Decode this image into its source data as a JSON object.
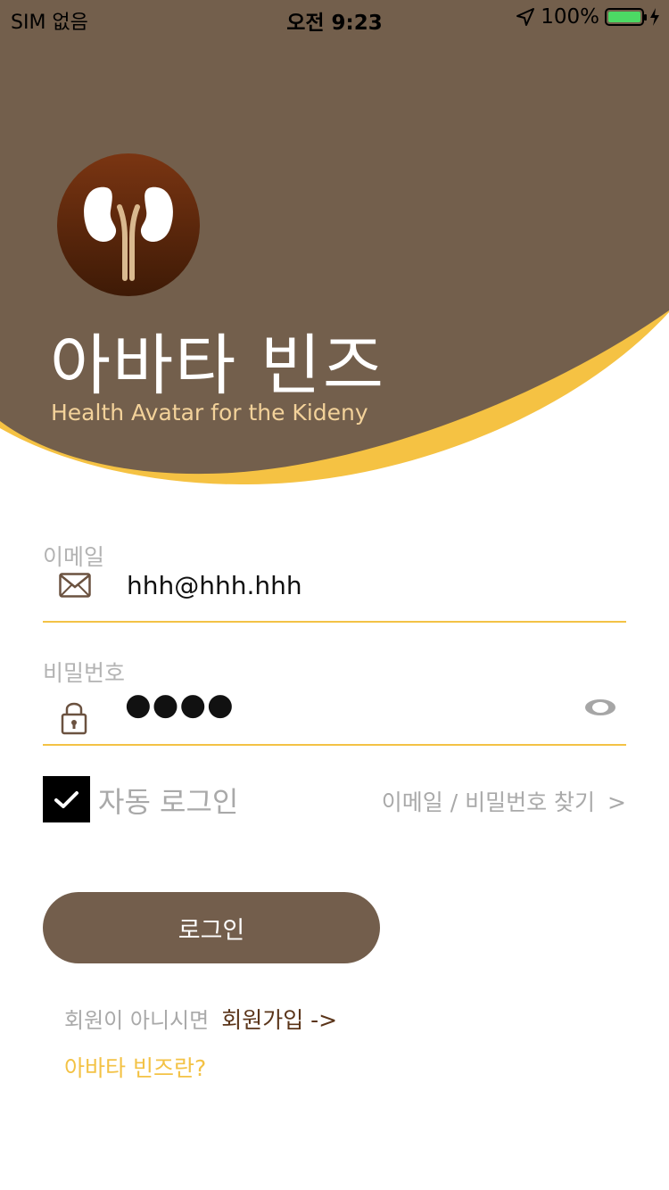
{
  "status_bar": {
    "carrier": "SIM 없음",
    "time": "오전 9:23",
    "battery": "100%"
  },
  "brand": {
    "title": "아바타 빈즈",
    "subtitle": "Health Avatar for the Kideny"
  },
  "form": {
    "email_label": "이메일",
    "email_value": "hhh@hhh.hhh",
    "password_label": "비밀번호",
    "password_masked": "●●●●",
    "auto_login_label": "자동 로그인",
    "auto_login_checked": true,
    "find_link": "이메일 / 비밀번호 찾기",
    "find_arrow": ">",
    "login_button": "로그인",
    "signup_question": "회원이 아니시면",
    "signup_link": "회원가입 ->",
    "about_link": "아바타 빈즈란?"
  },
  "colors": {
    "header_brown": "#735f4c",
    "accent_yellow": "#f5c243",
    "logo_brown": "#6b2e10",
    "subtitle_gold": "#f3d29a",
    "signup_link": "#5a3419"
  },
  "icons": [
    "envelope-icon",
    "lock-icon",
    "eye-icon",
    "check-icon",
    "location-arrow-icon",
    "charging-bolt-icon",
    "kidney-logo"
  ]
}
